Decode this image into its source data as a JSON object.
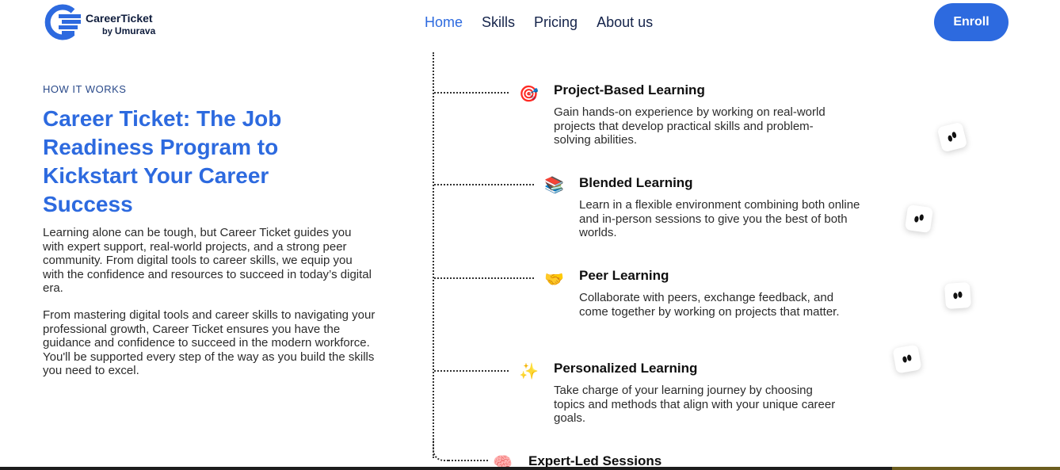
{
  "brand": {
    "name": "CareerTicket",
    "by": "by",
    "company": "Umurava",
    "color": "#2d6adf"
  },
  "nav": {
    "items": [
      {
        "label": "Home",
        "active": true
      },
      {
        "label": "Skills",
        "active": false
      },
      {
        "label": "Pricing",
        "active": false
      },
      {
        "label": "About us",
        "active": false
      }
    ],
    "enroll_label": "Enroll"
  },
  "hero": {
    "eyebrow": "HOW IT WORKS",
    "title": "Career Ticket: The Job Readiness Program to Kickstart Your Career Success",
    "paragraph1": "Learning alone can be tough, but Career Ticket guides you with expert support, real-world projects, and a strong peer community. From digital tools to career skills, we equip you with the confidence and resources to succeed in today’s digital era.",
    "paragraph2": "From mastering digital tools and career skills to navigating your professional growth, Career Ticket ensures you have the guidance and confidence to succeed in the modern workforce. You'll be supported every step of the way as you build the skills you need to excel."
  },
  "steps": [
    {
      "icon": "target-icon",
      "emoji": "🎯",
      "title": "Project-Based Learning",
      "description": "Gain hands-on experience by working on real-world projects that develop practical skills and problem-solving abilities."
    },
    {
      "icon": "books-icon",
      "emoji": "📚",
      "title": "Blended Learning",
      "description": "Learn in a flexible environment combining both online and in-person sessions to give you the best of both worlds."
    },
    {
      "icon": "handshake-icon",
      "emoji": "🤝",
      "title": "Peer Learning",
      "description": "Collaborate with peers, exchange feedback, and come together by working on projects that matter."
    },
    {
      "icon": "sparkles-icon",
      "emoji": "✨",
      "title": "Personalized Learning",
      "description": "Take charge of your learning journey by choosing topics and methods that align with your unique career goals."
    },
    {
      "icon": "brain-icon",
      "emoji": "🧠",
      "title": "Expert-Led Sessions",
      "description": ""
    }
  ]
}
